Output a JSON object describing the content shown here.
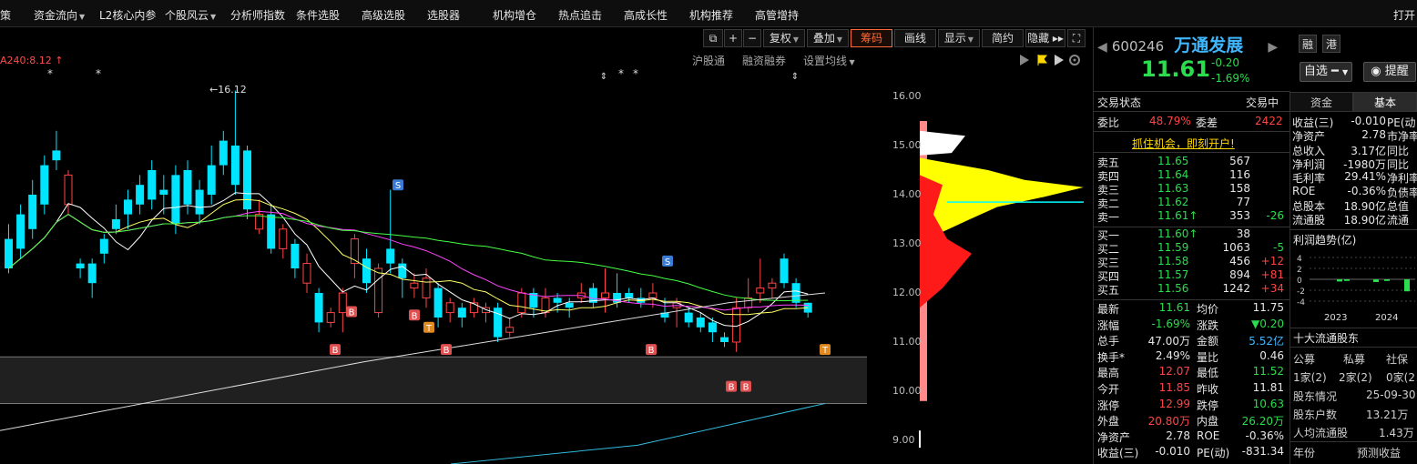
{
  "topmenu": {
    "items": [
      {
        "label": "策",
        "dd": false
      },
      {
        "label": "资金流向",
        "dd": true
      },
      {
        "label": "L2核心内参",
        "dd": false
      },
      {
        "label": "个股风云",
        "dd": true
      },
      {
        "label": "分析师指数",
        "dd": false
      },
      {
        "label": "条件选股",
        "dd": false
      },
      {
        "label": "高级选股",
        "dd": false
      },
      {
        "label": "选股器",
        "dd": false
      },
      {
        "label": "机构增仓",
        "dd": false
      },
      {
        "label": "热点追击",
        "dd": false
      },
      {
        "label": "高成长性",
        "dd": false
      },
      {
        "label": "机构推荐",
        "dd": false
      },
      {
        "label": "高管增持",
        "dd": false
      },
      {
        "label": "打开",
        "dd": false
      }
    ]
  },
  "toolbar": {
    "icons": [
      "⧉",
      "+",
      "−"
    ],
    "fq": "复权",
    "overlay": "叠加",
    "chips": "筹码",
    "draw": "画线",
    "display": "显示",
    "simple": "简约",
    "hide": "隐藏 ▸▸",
    "fullscreen": "⛶"
  },
  "subbar": {
    "ma_label": "A240:8.12",
    "hgt": "沪股通",
    "margin": "融资融券",
    "set_ma": "设置均线"
  },
  "chart": {
    "high_label": "16.12",
    "price_ticks": [
      "16.00",
      "15.00",
      "14.00",
      "13.00",
      "12.00",
      "11.00",
      "10.00",
      "9.00"
    ],
    "signal_b": "B",
    "signal_s": "S",
    "signal_t": "T"
  },
  "quote": {
    "code": "600246",
    "name": "万通发展",
    "price": "11.61",
    "change": "-0.20",
    "pct": "-1.69%",
    "rong": "融",
    "gang": "港",
    "watch": "自选",
    "alert": "提醒"
  },
  "status": {
    "label": "交易状态",
    "value": "交易中",
    "webi_label": "委比",
    "webi": "48.79%",
    "weicha_label": "委差",
    "weicha": "2422",
    "promo": "抓住机会，即刻开户!"
  },
  "sell": [
    {
      "label": "卖五",
      "price": "11.65",
      "vol": "567",
      "chg": ""
    },
    {
      "label": "卖四",
      "price": "11.64",
      "vol": "116",
      "chg": ""
    },
    {
      "label": "卖三",
      "price": "11.63",
      "vol": "158",
      "chg": ""
    },
    {
      "label": "卖二",
      "price": "11.62",
      "vol": "77",
      "chg": ""
    },
    {
      "label": "卖一",
      "price": "11.61↑",
      "vol": "353",
      "chg": "-26"
    }
  ],
  "buy": [
    {
      "label": "买一",
      "price": "11.60↑",
      "vol": "38",
      "chg": ""
    },
    {
      "label": "买二",
      "price": "11.59",
      "vol": "1063",
      "chg": "-5"
    },
    {
      "label": "买三",
      "price": "11.58",
      "vol": "456",
      "chg": "+12"
    },
    {
      "label": "买四",
      "price": "11.57",
      "vol": "894",
      "chg": "+81"
    },
    {
      "label": "买五",
      "price": "11.56",
      "vol": "1242",
      "chg": "+34"
    }
  ],
  "stats": [
    {
      "l1": "最新",
      "v1": "11.61",
      "c1": "g",
      "l2": "均价",
      "v2": "11.75",
      "c2": "w"
    },
    {
      "l1": "涨幅",
      "v1": "-1.69%",
      "c1": "g",
      "l2": "涨跌",
      "v2": "▼0.20",
      "c2": "g"
    },
    {
      "l1": "总手",
      "v1": "47.00万",
      "c1": "w",
      "l2": "金额",
      "v2": "5.52亿",
      "c2": "c"
    },
    {
      "l1": "换手*",
      "v1": "2.49%",
      "c1": "w",
      "l2": "量比",
      "v2": "0.46",
      "c2": "w"
    },
    {
      "l1": "最高",
      "v1": "12.07",
      "c1": "r",
      "l2": "最低",
      "v2": "11.52",
      "c2": "g"
    },
    {
      "l1": "今开",
      "v1": "11.85",
      "c1": "r",
      "l2": "昨收",
      "v2": "11.81",
      "c2": "w"
    },
    {
      "l1": "涨停",
      "v1": "12.99",
      "c1": "r",
      "l2": "跌停",
      "v2": "10.63",
      "c2": "g"
    },
    {
      "l1": "外盘",
      "v1": "20.80万",
      "c1": "r",
      "l2": "内盘",
      "v2": "26.20万",
      "c2": "g"
    },
    {
      "l1": "净资产",
      "v1": "2.78",
      "c1": "w",
      "l2": "ROE",
      "v2": "-0.36%",
      "c2": "w"
    },
    {
      "l1": "收益(三)",
      "v1": "-0.010",
      "c1": "w",
      "l2": "PE(动)",
      "v2": "-831.34",
      "c2": "w"
    }
  ],
  "tabs": {
    "zijin": "资金",
    "jiben": "基本"
  },
  "fundamentals": [
    {
      "label": "收益(三)",
      "value": "-0.010",
      "extra": "PE(动"
    },
    {
      "label": "净资产",
      "value": "2.78",
      "extra": "市净率"
    },
    {
      "label": "总收入",
      "value": "3.17亿",
      "extra": "同比"
    },
    {
      "label": "净利润",
      "value": "-1980万",
      "extra": "同比"
    },
    {
      "label": "毛利率",
      "value": "29.41%",
      "extra": "净利率"
    },
    {
      "label": "ROE",
      "value": "-0.36%",
      "extra": "负债率"
    },
    {
      "label": "总股本",
      "value": "18.90亿",
      "extra": "总值"
    },
    {
      "label": "流通股",
      "value": "18.90亿",
      "extra": "流通"
    }
  ],
  "profit": {
    "title": "利润趋势(亿)",
    "yticks": [
      "4",
      "2",
      "0",
      "-2",
      "-4"
    ],
    "years": [
      "2023",
      "2024"
    ]
  },
  "holders": {
    "title": "十大流通股东",
    "cols": [
      "公募",
      "私募",
      "社保"
    ],
    "vals": [
      "1家(2)",
      "2家(2)",
      "0家(2"
    ],
    "rows": [
      {
        "label": "股东情况",
        "value": "25-09-30"
      },
      {
        "label": "股东户数",
        "value": "13.21万"
      },
      {
        "label": "人均流通股",
        "value": "1.43万"
      }
    ],
    "foot_l": "年份",
    "foot_r": "预测收益"
  },
  "colors": {
    "up": "#ff4545",
    "down": "#2bdc4e",
    "candle_down": "#00e5ff",
    "accent": "#3fb7ff"
  }
}
